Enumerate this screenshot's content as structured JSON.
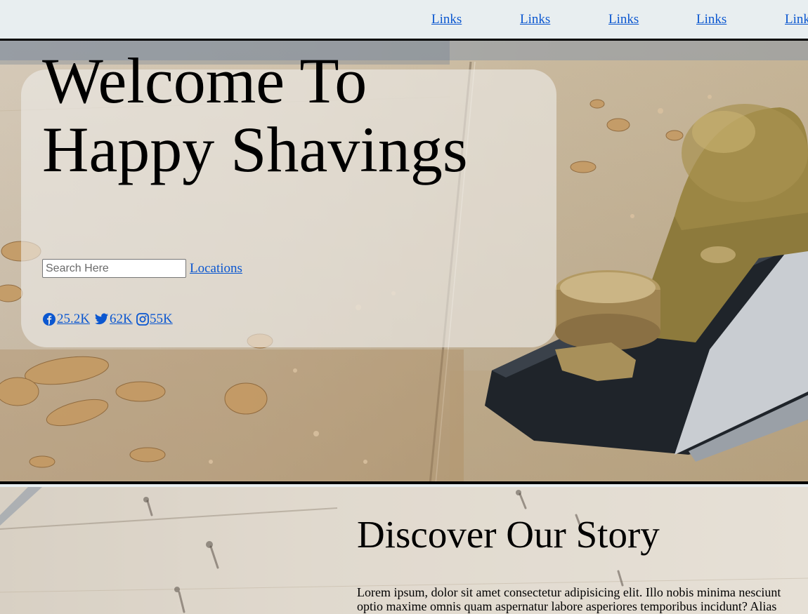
{
  "nav": {
    "links": [
      "Links",
      "Links",
      "Links",
      "Links",
      "Links"
    ]
  },
  "hero": {
    "title_line1": "Welcome To",
    "title_line2": "Happy Shavings",
    "search_placeholder": "Search Here",
    "locations_label": "Locations",
    "social": {
      "facebook": "25.2K",
      "twitter": "62K",
      "instagram": "55K"
    }
  },
  "story": {
    "title": "Discover Our Story",
    "line1": "Lorem ipsum, dolor sit amet consectetur adipisicing elit. Illo nobis minima nesciunt",
    "line2": "optio maxime omnis quam aspernatur labore asperiores temporibus incidunt? Alias"
  },
  "icons": [
    "facebook-icon",
    "twitter-icon",
    "instagram-icon"
  ],
  "colors": {
    "link": "#0b57d0",
    "nav_background": "#e8eef0",
    "card_background": "rgba(238,236,232,0.62)"
  }
}
